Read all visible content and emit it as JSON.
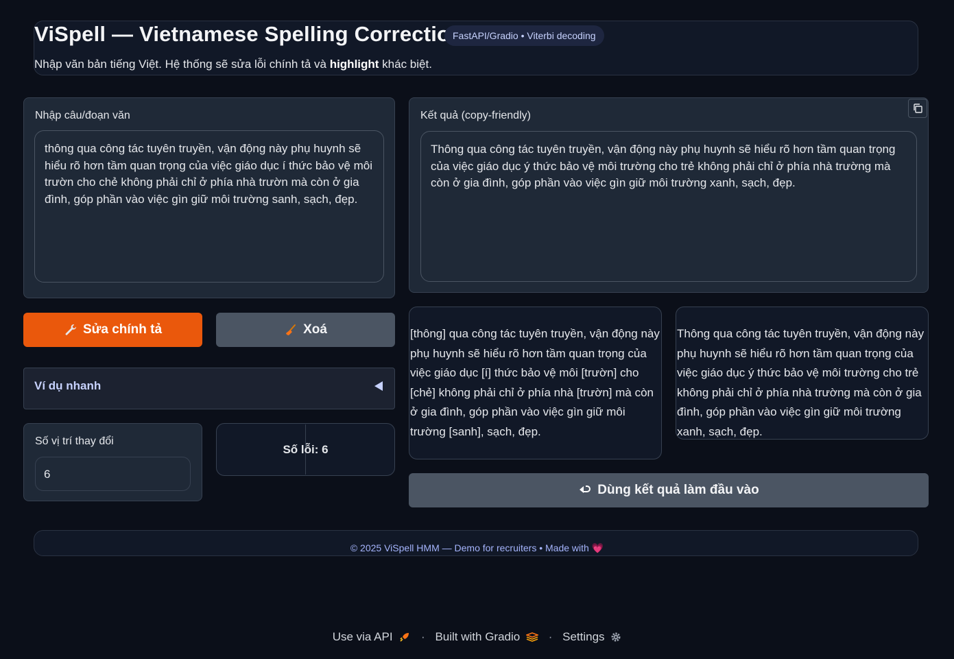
{
  "header": {
    "title": "ViSpell — Vietnamese Spelling Correction",
    "badge": "FastAPI/Gradio • Viterbi decoding",
    "subtitle_pre": "Nhập văn bản tiếng Việt. Hệ thống sẽ sửa lỗi chính tả và ",
    "subtitle_bold": "highlight",
    "subtitle_post": " khác biệt."
  },
  "input": {
    "label": "Nhập câu/đoạn văn",
    "value": "thông qua công tác tuyên truyền, vận động này phụ huynh sẽ hiểu rõ hơn tầm quan trọng của việc giáo dục í thức bảo vệ môi trườn cho chẻ không phải chỉ ở phía nhà trườn mà còn ở gia đình, góp phần vào việc gìn giữ môi trường sanh, sạch, đẹp."
  },
  "output": {
    "label": "Kết quả (copy-friendly)",
    "value": "Thông qua công tác tuyên truyền, vận động này phụ huynh sẽ hiểu rõ hơn tầm quan trọng của việc giáo dục ý thức bảo vệ môi trường cho trẻ không phải chỉ ở phía nhà trường mà còn ở gia đình, góp phần vào việc gìn giữ môi trường xanh, sạch, đẹp."
  },
  "buttons": {
    "fix_label": "Sửa chính tả",
    "fix_icon": "wrench-icon",
    "clear_label": "Xoá",
    "clear_icon": "broom-icon",
    "use_result_label": "Dùng kết quả làm đầu vào",
    "use_result_icon": "return-arrow-icon"
  },
  "examples": {
    "label": "Ví dụ nhanh"
  },
  "stats": {
    "changes_label": "Số vị trí thay đổi",
    "changes_value": "6",
    "errors_text": "Số lỗi: 6"
  },
  "diff": {
    "original_marked": "[thông] qua công tác tuyên truyền, vận động này phụ huynh sẽ hiểu rõ hơn tầm quan trọng của việc giáo dục [í] thức bảo vệ môi [trườn] cho [chẻ] không phải chỉ ở phía nhà [trườn] mà còn ở gia đình, góp phần vào việc gìn giữ môi trường [sanh], sạch, đẹp.",
    "corrected": "Thông qua công tác tuyên truyền, vận động này phụ huynh sẽ hiểu rõ hơn tầm quan trọng của việc giáo dục ý thức bảo vệ môi trường cho trẻ không phải chỉ ở phía nhà trường mà còn ở gia đình, góp phần vào việc gìn giữ môi trường xanh, sạch, đẹp."
  },
  "footer": {
    "text": "© 2025 ViSpell HMM — Demo for recruiters • Made with",
    "heart": "💗"
  },
  "gradio_footer": {
    "api": "Use via API",
    "built": "Built with Gradio",
    "settings": "Settings",
    "sep": "·"
  },
  "colors": {
    "background": "#0b0f19",
    "primary_button": "#ea580c",
    "secondary_button": "#4b5563"
  }
}
